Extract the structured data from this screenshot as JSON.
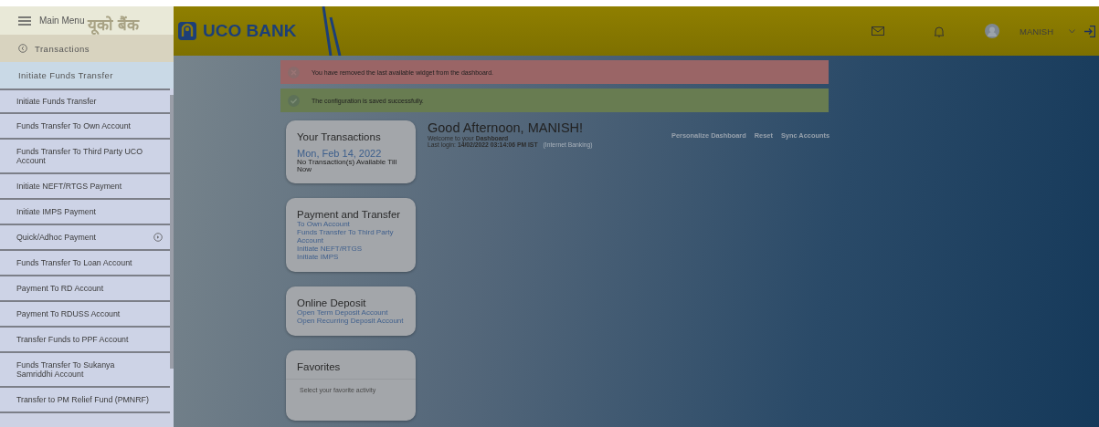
{
  "header": {
    "logo_hindi": "यूको बैंक",
    "logo_text": "UCO BANK",
    "user": "MANISH"
  },
  "sidebar": {
    "main_menu": "Main Menu",
    "back": "Transactions",
    "section": "Initiate Funds Transfer",
    "items": [
      {
        "label": "Initiate Funds Transfer",
        "expandable": false
      },
      {
        "label": "Funds Transfer To Own Account",
        "expandable": false
      },
      {
        "label": "Funds Transfer To Third Party UCO Account",
        "expandable": false
      },
      {
        "label": "Initiate NEFT/RTGS Payment",
        "expandable": false
      },
      {
        "label": "Initiate IMPS Payment",
        "expandable": false
      },
      {
        "label": "Quick/Adhoc Payment",
        "expandable": true
      },
      {
        "label": "Funds Transfer To Loan Account",
        "expandable": false
      },
      {
        "label": "Payment To RD Account",
        "expandable": false
      },
      {
        "label": "Payment To RDUSS Account",
        "expandable": false
      },
      {
        "label": "Transfer Funds to PPF Account",
        "expandable": false
      },
      {
        "label": "Funds Transfer To Sukanya Samriddhi Account",
        "expandable": false
      },
      {
        "label": "Transfer to PM Relief Fund (PMNRF)",
        "expandable": false
      }
    ]
  },
  "alerts": [
    {
      "kind": "error",
      "text": "You have removed the last available widget from the dashboard."
    },
    {
      "kind": "success",
      "text": "The configuration is saved successfully."
    }
  ],
  "cards": [
    {
      "kind": "summary",
      "title": "Your Transactions",
      "date": "Mon, Feb 14, 2022",
      "note": "No Transaction(s) Available Till Now"
    },
    {
      "kind": "links",
      "title": "Payment and Transfer",
      "links": [
        "To Own Account",
        "Funds Transfer To Third Party Account",
        "Initiate NEFT/RTGS",
        "Initiate IMPS"
      ]
    },
    {
      "kind": "links",
      "title": "Online Deposit",
      "links": [
        "Open Term Deposit Account",
        "Open Recurring Deposit Account"
      ]
    },
    {
      "kind": "favorites",
      "title": "Favorites",
      "note": "Select your favorite activity"
    }
  ],
  "greeting": {
    "title": "Good Afternoon, MANISH!",
    "welcome": "Welcome to your **Dashboard**",
    "last_login": "Last login: **14/02/2022 03:14:06 PM IST**",
    "channel": "(Internet Banking)"
  },
  "actions": [
    "Personalize Dashboard",
    "Reset",
    "Sync Accounts"
  ]
}
